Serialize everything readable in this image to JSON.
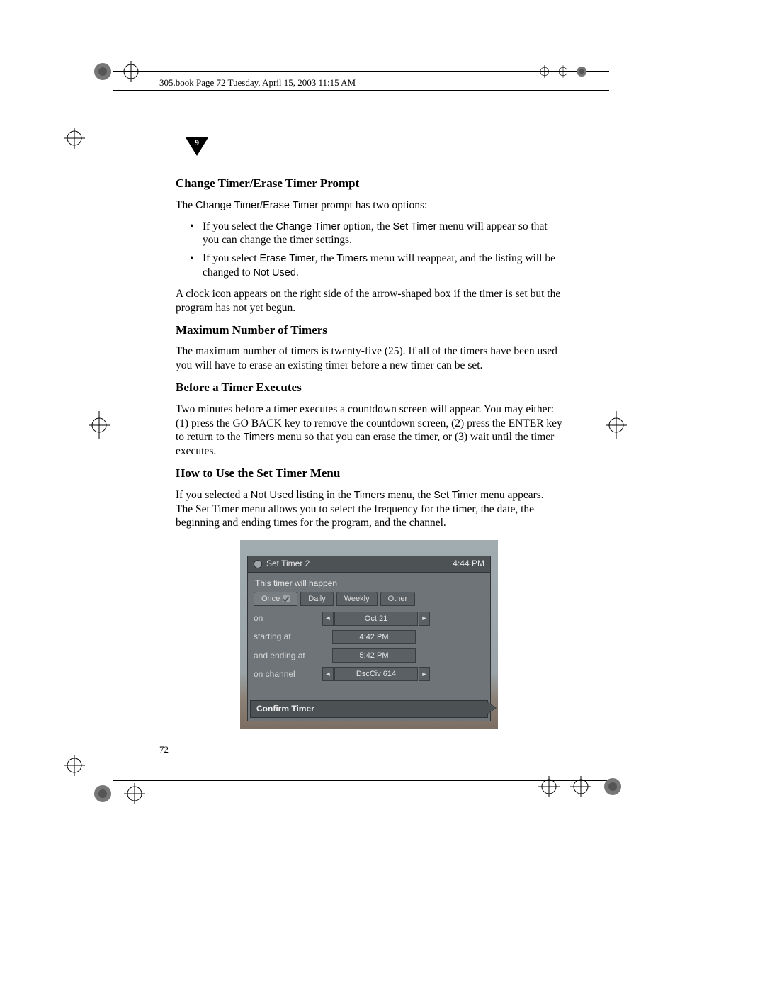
{
  "header_meta": "305.book  Page 72  Tuesday, April 15, 2003  11:15 AM",
  "chapter_number": "9",
  "page_number": "72",
  "sections": {
    "s1": {
      "heading": "Change Timer/Erase Timer Prompt",
      "intro_a": "The ",
      "intro_b": "Change Timer/Erase Timer",
      "intro_c": " prompt has two options:",
      "bullet1_a": "If you select the ",
      "bullet1_b": "Change Timer",
      "bullet1_c": " option, the ",
      "bullet1_d": "Set Timer",
      "bullet1_e": " menu will appear so that you can change the timer settings.",
      "bullet2_a": "If you select ",
      "bullet2_b": "Erase Timer",
      "bullet2_c": ", the ",
      "bullet2_d": "Timers",
      "bullet2_e": " menu will reappear, and the listing will be changed to ",
      "bullet2_f": "Not Used",
      "bullet2_g": ".",
      "after": "A clock icon appears on the right side of the arrow-shaped box if the timer is set but the program has not yet begun."
    },
    "s2": {
      "heading": "Maximum Number of Timers",
      "body": "The maximum number of timers is twenty-five (25). If all of the timers have been used you will have to erase an existing timer before a new timer can be set."
    },
    "s3": {
      "heading": "Before a Timer Executes",
      "body_a": "Two minutes before a timer executes a countdown screen will appear. You may either: (1) press the GO BACK key to remove the countdown screen, (2) press the ENTER key to return to the ",
      "body_b": "Timers",
      "body_c": " menu so that you can erase the timer, or (3) wait until the timer executes."
    },
    "s4": {
      "heading": "How to Use the Set Timer Menu",
      "body_a": "If you selected a ",
      "body_b": "Not Used",
      "body_c": " listing in the ",
      "body_d": "Timers",
      "body_e": " menu, the ",
      "body_f": "Set Timer",
      "body_g": " menu appears. The Set Timer menu allows you to select the frequency for the timer, the date, the beginning and ending times for the program, and the channel."
    }
  },
  "menu": {
    "title": "Set Timer 2",
    "clock": "4:44 PM",
    "subtitle": "This timer will happen",
    "tabs": {
      "once": "Once",
      "daily": "Daily",
      "weekly": "Weekly",
      "other": "Other"
    },
    "labels": {
      "on": "on",
      "starting": "starting at",
      "ending": "and ending at",
      "channel": "on channel"
    },
    "values": {
      "date": "Oct 21",
      "start": "4:42 PM",
      "end": "5:42 PM",
      "channel": "DscCiv 614"
    },
    "confirm": "Confirm Timer"
  }
}
